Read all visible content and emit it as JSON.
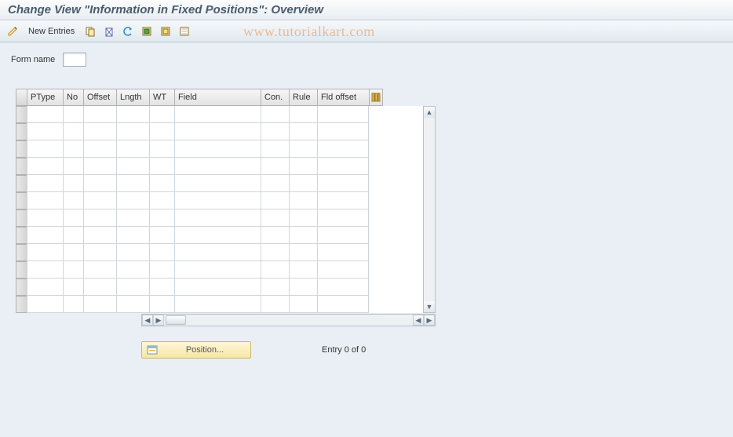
{
  "header": {
    "title": "Change View \"Information in Fixed Positions\": Overview"
  },
  "toolbar": {
    "new_entries": "New Entries"
  },
  "watermark": "www.tutorialkart.com",
  "form": {
    "form_name_label": "Form name",
    "form_name_value": ""
  },
  "grid": {
    "columns": {
      "ptype": "PType",
      "no": "No",
      "offset": "Offset",
      "lngth": "Lngth",
      "wt": "WT",
      "field": "Field",
      "con": "Con.",
      "rule": "Rule",
      "fldoffset": "Fld offset"
    },
    "rows": 12
  },
  "footer": {
    "position_label": "Position...",
    "entry_text": "Entry 0 of 0"
  }
}
